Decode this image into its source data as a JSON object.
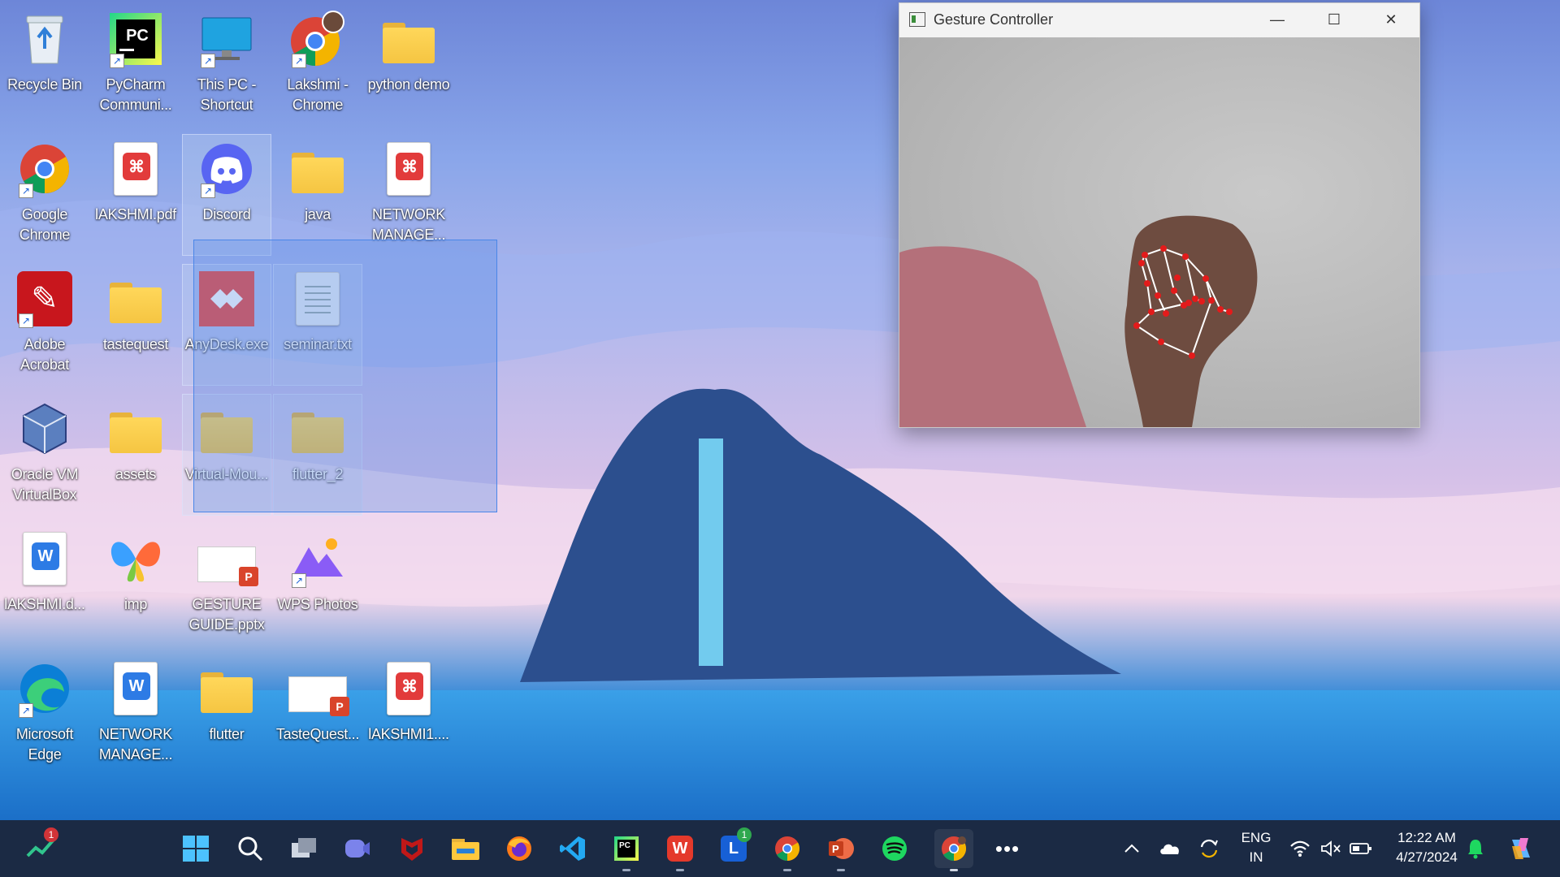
{
  "desktop": {
    "icons": [
      {
        "label": "Recycle Bin",
        "kind": "recycle-bin-icon"
      },
      {
        "label": "PyCharm Communi...",
        "kind": "pycharm-icon"
      },
      {
        "label": "This PC - Shortcut",
        "kind": "this-pc-icon"
      },
      {
        "label": "Lakshmi - Chrome",
        "kind": "chrome-profile-icon"
      },
      {
        "label": "python demo",
        "kind": "folder-icon"
      },
      {
        "label": "Google Chrome",
        "kind": "chrome-icon"
      },
      {
        "label": "lAKSHMI.pdf",
        "kind": "pdf-icon"
      },
      {
        "label": "Discord",
        "kind": "discord-icon"
      },
      {
        "label": "java",
        "kind": "folder-icon"
      },
      {
        "label": "NETWORK MANAGE...",
        "kind": "pdf-icon"
      },
      {
        "label": "Adobe Acrobat",
        "kind": "acrobat-icon"
      },
      {
        "label": "tastequest",
        "kind": "folder-icon"
      },
      {
        "label": "AnyDesk.exe",
        "kind": "anydesk-icon"
      },
      {
        "label": "seminar.txt",
        "kind": "text-file-icon"
      },
      {
        "label": "Oracle VM VirtualBox",
        "kind": "virtualbox-icon"
      },
      {
        "label": "assets",
        "kind": "folder-icon"
      },
      {
        "label": "Virtual-Mou...",
        "kind": "folder-icon"
      },
      {
        "label": "flutter_2",
        "kind": "folder-icon"
      },
      {
        "label": "lAKSHMI.d...",
        "kind": "word-doc-icon"
      },
      {
        "label": "imp",
        "kind": "butterfly-icon"
      },
      {
        "label": "GESTURE GUIDE.pptx",
        "kind": "pptx-icon"
      },
      {
        "label": "WPS Photos",
        "kind": "wps-photos-icon"
      },
      {
        "label": "Microsoft Edge",
        "kind": "edge-icon"
      },
      {
        "label": "NETWORK MANAGE...",
        "kind": "word-doc-icon"
      },
      {
        "label": "flutter",
        "kind": "folder-icon"
      },
      {
        "label": "TasteQuest...",
        "kind": "pptx-icon"
      },
      {
        "label": "lAKSHMI1....",
        "kind": "pdf-icon"
      }
    ]
  },
  "window": {
    "title": "Gesture Controller",
    "minimize": "—",
    "maximize": "☐",
    "close": "✕"
  },
  "taskbar": {
    "badges": {
      "stocks": "1",
      "launcher": "1"
    },
    "apps": [
      "start-icon",
      "search-icon",
      "task-view-icon",
      "meet-icon",
      "mcafee-icon",
      "file-explorer-icon",
      "firefox-icon",
      "vscode-icon",
      "pycharm-icon",
      "wps-office-icon",
      "launcher-icon",
      "chrome-icon",
      "powerpoint-icon",
      "spotify-icon",
      "chrome-profile-icon",
      "more-icon"
    ],
    "tray": {
      "lang_line1": "ENG",
      "lang_line2": "IN",
      "time": "12:22 AM",
      "date": "4/27/2024"
    }
  }
}
